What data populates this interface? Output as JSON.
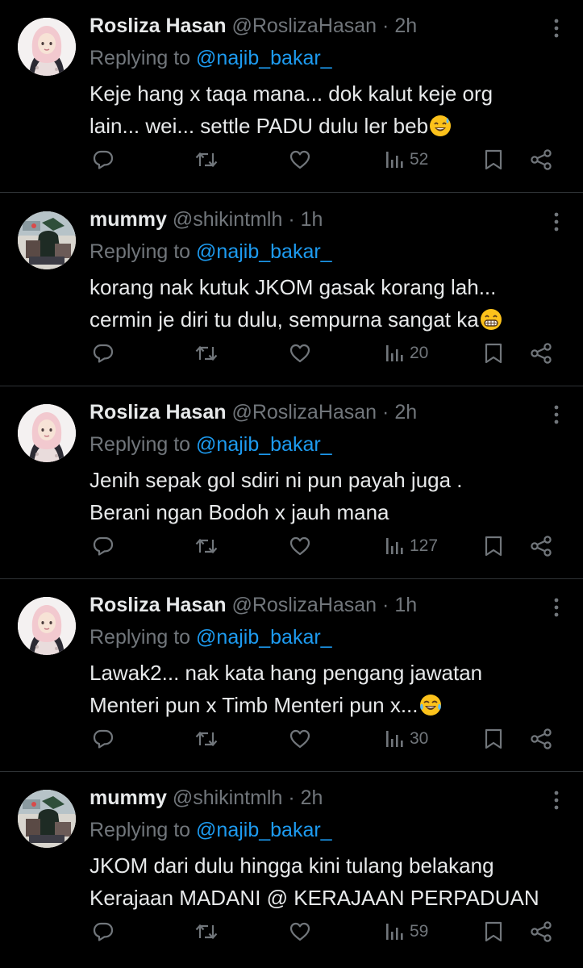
{
  "tweets": [
    {
      "name": "Rosliza Hasan",
      "handle": "@RoslizaHasan",
      "dot": "·",
      "time": "2h",
      "replying_prefix": "Replying to ",
      "replying_to": "@najib_bakar_",
      "lines": [
        "Keje hang x taqa mana... dok kalut keje org",
        "lain... wei... settle PADU dulu ler beb"
      ],
      "emoji": "sweat-smile",
      "views": "52",
      "avatar": "hijab-woman"
    },
    {
      "name": "mummy",
      "handle": "@shikintmlh",
      "dot": "·",
      "time": "1h",
      "replying_prefix": "Replying to ",
      "replying_to": "@najib_bakar_",
      "lines": [
        "korang nak kutuk JKOM gasak korang lah...",
        "cermin je diri tu dulu, sempurna sangat ka"
      ],
      "emoji": "grin",
      "views": "20",
      "avatar": "collage"
    },
    {
      "name": "Rosliza Hasan",
      "handle": "@RoslizaHasan",
      "dot": "·",
      "time": "2h",
      "replying_prefix": "Replying to ",
      "replying_to": "@najib_bakar_",
      "lines": [
        "Jenih sepak gol sdiri ni pun payah juga .",
        "Berani ngan Bodoh x jauh mana"
      ],
      "emoji": "",
      "views": "127",
      "avatar": "hijab-woman"
    },
    {
      "name": "Rosliza Hasan",
      "handle": "@RoslizaHasan",
      "dot": "·",
      "time": "1h",
      "replying_prefix": "Replying to ",
      "replying_to": "@najib_bakar_",
      "lines": [
        "Lawak2... nak kata hang pengang jawatan",
        "Menteri pun x Timb Menteri pun x..."
      ],
      "emoji": "joy",
      "views": "30",
      "avatar": "hijab-woman"
    },
    {
      "name": "mummy",
      "handle": "@shikintmlh",
      "dot": "·",
      "time": "2h",
      "replying_prefix": "Replying to ",
      "replying_to": "@najib_bakar_",
      "lines": [
        "JKOM dari dulu hingga kini tulang belakang",
        "Kerajaan MADANI @ KERAJAAN PERPADUAN"
      ],
      "emoji": "",
      "views": "59",
      "avatar": "collage"
    }
  ],
  "icons": {
    "reply": "reply-icon",
    "retweet": "retweet-icon",
    "like": "like-icon",
    "views": "views-icon",
    "bookmark": "bookmark-icon",
    "share": "share-icon",
    "more": "more-icon"
  },
  "colors": {
    "background": "#000000",
    "text": "#e7e9ea",
    "muted": "#71767b",
    "link": "#1d9bf0",
    "divider": "#2f3336"
  }
}
